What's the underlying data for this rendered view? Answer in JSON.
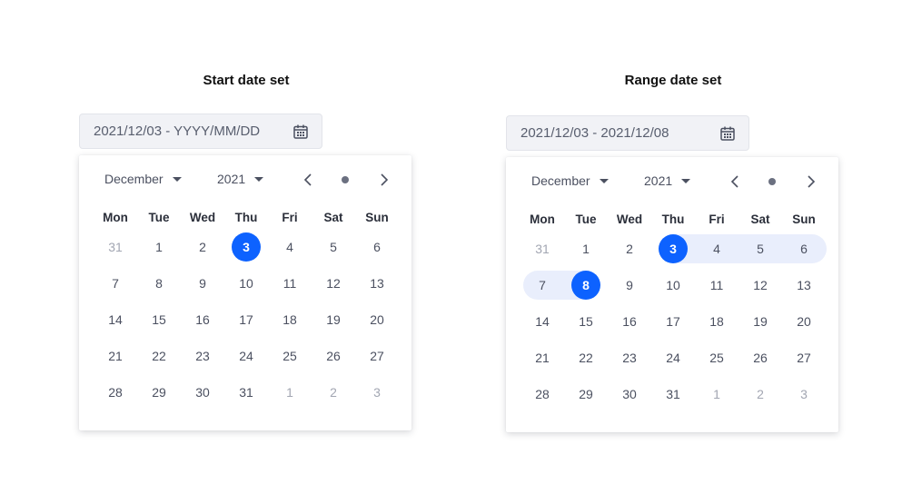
{
  "weekdays": [
    "Mon",
    "Tue",
    "Wed",
    "Thu",
    "Fri",
    "Sat",
    "Sun"
  ],
  "colors": {
    "accent": "#0d62ff",
    "range_bg": "#e9eefc",
    "field_bg": "#f1f2f6"
  },
  "left": {
    "title": "Start date set",
    "field_value": "2021/12/03 - YYYY/MM/DD",
    "month": "December",
    "year": "2021",
    "weeks": [
      [
        {
          "d": "31",
          "muted": true
        },
        {
          "d": "1"
        },
        {
          "d": "2"
        },
        {
          "d": "3",
          "state": "selected"
        },
        {
          "d": "4"
        },
        {
          "d": "5"
        },
        {
          "d": "6"
        }
      ],
      [
        {
          "d": "7"
        },
        {
          "d": "8"
        },
        {
          "d": "9"
        },
        {
          "d": "10"
        },
        {
          "d": "11"
        },
        {
          "d": "12"
        },
        {
          "d": "13"
        }
      ],
      [
        {
          "d": "14"
        },
        {
          "d": "15"
        },
        {
          "d": "16"
        },
        {
          "d": "17"
        },
        {
          "d": "18"
        },
        {
          "d": "19"
        },
        {
          "d": "20"
        }
      ],
      [
        {
          "d": "21"
        },
        {
          "d": "22"
        },
        {
          "d": "23"
        },
        {
          "d": "24"
        },
        {
          "d": "25"
        },
        {
          "d": "26"
        },
        {
          "d": "27"
        }
      ],
      [
        {
          "d": "28"
        },
        {
          "d": "29"
        },
        {
          "d": "30"
        },
        {
          "d": "31"
        },
        {
          "d": "1",
          "muted": true
        },
        {
          "d": "2",
          "muted": true
        },
        {
          "d": "3",
          "muted": true
        }
      ]
    ]
  },
  "right": {
    "title": "Range date set",
    "field_value": "2021/12/03 - 2021/12/08",
    "month": "December",
    "year": "2021",
    "weeks": [
      [
        {
          "d": "31",
          "muted": true
        },
        {
          "d": "1"
        },
        {
          "d": "2"
        },
        {
          "d": "3",
          "state": "range-start"
        },
        {
          "d": "4",
          "state": "inrange"
        },
        {
          "d": "5",
          "state": "inrange"
        },
        {
          "d": "6",
          "state": "inrange",
          "round": "r"
        }
      ],
      [
        {
          "d": "7",
          "state": "inrange",
          "round": "l"
        },
        {
          "d": "8",
          "state": "range-end"
        },
        {
          "d": "9"
        },
        {
          "d": "10"
        },
        {
          "d": "11"
        },
        {
          "d": "12"
        },
        {
          "d": "13"
        }
      ],
      [
        {
          "d": "14"
        },
        {
          "d": "15"
        },
        {
          "d": "16"
        },
        {
          "d": "17"
        },
        {
          "d": "18"
        },
        {
          "d": "19"
        },
        {
          "d": "20"
        }
      ],
      [
        {
          "d": "21"
        },
        {
          "d": "22"
        },
        {
          "d": "23"
        },
        {
          "d": "24"
        },
        {
          "d": "25"
        },
        {
          "d": "26"
        },
        {
          "d": "27"
        }
      ],
      [
        {
          "d": "28"
        },
        {
          "d": "29"
        },
        {
          "d": "30"
        },
        {
          "d": "31"
        },
        {
          "d": "1",
          "muted": true
        },
        {
          "d": "2",
          "muted": true
        },
        {
          "d": "3",
          "muted": true
        }
      ]
    ]
  }
}
